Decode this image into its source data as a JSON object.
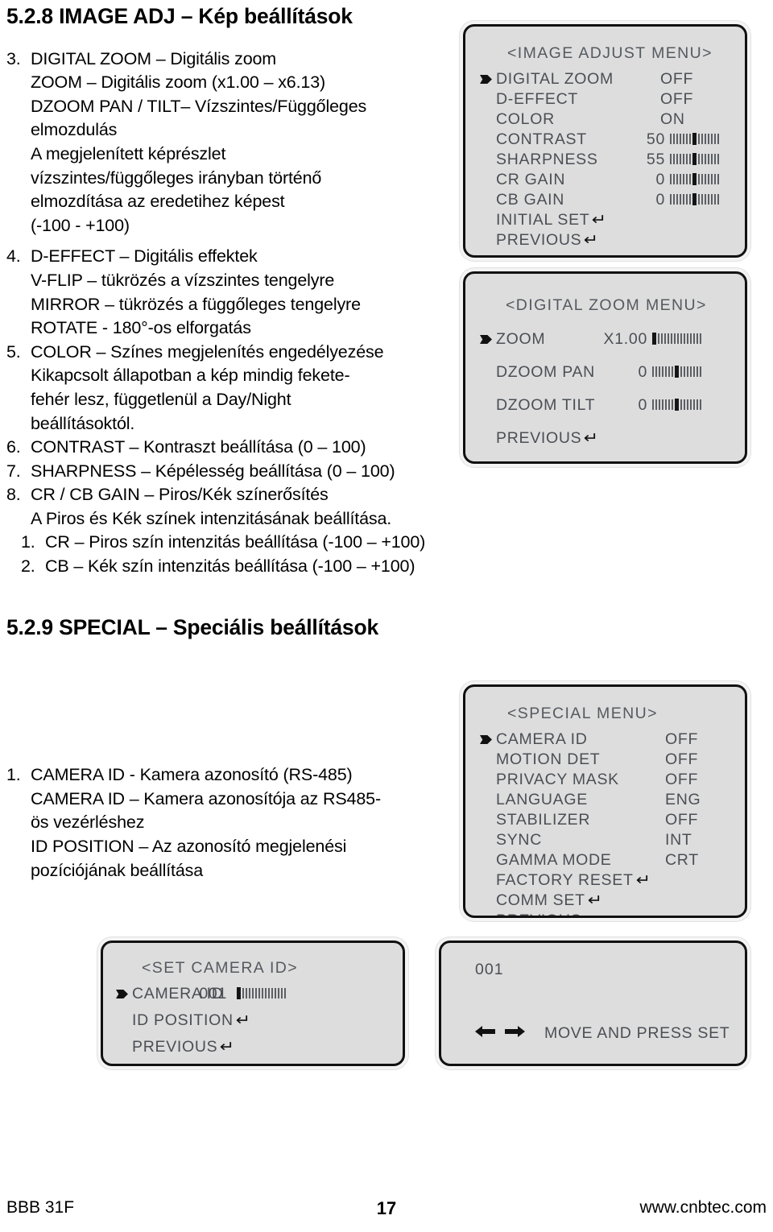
{
  "document": {
    "section_1": {
      "heading": "5.2.8 IMAGE ADJ – Kép beállítások",
      "items": [
        {
          "num": "3.",
          "lines": [
            "DIGITAL ZOOM – Digitális zoom",
            "ZOOM – Digitális zoom (x1.00 – x6.13)",
            "DZOOM PAN / TILT– Vízszintes/Függőleges",
            "elmozdulás",
            "A megjelenített képrészlet",
            "vízszintes/függőleges irányban történő",
            "elmozdítása az eredetihez képest",
            "(-100 - +100)"
          ]
        },
        {
          "num": "4.",
          "lines": [
            "D-EFFECT – Digitális effektek",
            "V-FLIP – tükrözés a vízszintes tengelyre",
            "MIRROR – tükrözés a függőleges tengelyre",
            "ROTATE - 180°-os elforgatás"
          ]
        },
        {
          "num": "5.",
          "lines": [
            "COLOR – Színes megjelenítés engedélyezése",
            "Kikapcsolt állapotban a kép mindig fekete-",
            "fehér lesz, függetlenül a Day/Night",
            "beállításoktól."
          ]
        },
        {
          "num": "6.",
          "lines": [
            "CONTRAST – Kontraszt beállítása (0 – 100)"
          ]
        },
        {
          "num": "7.",
          "lines": [
            "SHARPNESS – Képélesség beállítása (0 – 100)"
          ]
        },
        {
          "num": "8.",
          "lines": [
            "CR / CB GAIN – Piros/Kék színerősítés",
            "A Piros és Kék színek intenzitásának beállítása."
          ],
          "subitems": [
            {
              "num": "1.",
              "text": "CR – Piros szín intenzitás beállítása (-100 – +100)"
            },
            {
              "num": "2.",
              "text": "CB – Kék szín intenzitás beállítása (-100 – +100)"
            }
          ]
        }
      ]
    },
    "section_2": {
      "heading": "5.2.9 SPECIAL – Speciális beállítások",
      "items": [
        {
          "num": "1.",
          "lines": [
            "CAMERA ID - Kamera azonosító (RS-485)",
            "CAMERA ID – Kamera azonosítója az RS485-",
            "ös vezérléshez",
            "ID POSITION – Az azonosító megjelenési",
            "pozíciójának beállítása"
          ]
        }
      ]
    }
  },
  "osd_panels": {
    "image_adjust": {
      "title": "<IMAGE ADJUST MENU>",
      "rows": [
        {
          "cursor": true,
          "label": "DIGITAL ZOOM",
          "value": "OFF",
          "bar": null
        },
        {
          "cursor": false,
          "label": "D-EFFECT",
          "value": "OFF",
          "bar": null
        },
        {
          "cursor": false,
          "label": "COLOR",
          "value": "ON",
          "bar": null
        },
        {
          "cursor": false,
          "label": "CONTRAST",
          "value": "50",
          "bar": {
            "ticks": 15,
            "cursor_index": 7
          }
        },
        {
          "cursor": false,
          "label": "SHARPNESS",
          "value": "55",
          "bar": {
            "ticks": 15,
            "cursor_index": 7
          }
        },
        {
          "cursor": false,
          "label": "CR GAIN",
          "value": "0",
          "bar": {
            "ticks": 15,
            "cursor_index": 7
          }
        },
        {
          "cursor": false,
          "label": "CB GAIN",
          "value": "0",
          "bar": {
            "ticks": 15,
            "cursor_index": 7
          }
        },
        {
          "cursor": false,
          "label": "INITIAL SET",
          "value": "",
          "return": true
        },
        {
          "cursor": false,
          "label": "PREVIOUS",
          "value": "",
          "return": true
        }
      ]
    },
    "digital_zoom": {
      "title": "<DIGITAL ZOOM MENU>",
      "rows": [
        {
          "cursor": true,
          "label": "ZOOM",
          "value": "X1.00",
          "bar": {
            "ticks": 15,
            "cursor_index": 0
          }
        },
        {
          "cursor": false,
          "label": "DZOOM PAN",
          "value": "0",
          "bar": {
            "ticks": 15,
            "cursor_index": 7
          }
        },
        {
          "cursor": false,
          "label": "DZOOM TILT",
          "value": "0",
          "bar": {
            "ticks": 15,
            "cursor_index": 7
          }
        },
        {
          "cursor": false,
          "label": "PREVIOUS",
          "value": "",
          "return": true
        }
      ]
    },
    "special": {
      "title": "<SPECIAL MENU>",
      "rows": [
        {
          "cursor": true,
          "label": "CAMERA ID",
          "value": "OFF"
        },
        {
          "cursor": false,
          "label": "MOTION DET",
          "value": "OFF"
        },
        {
          "cursor": false,
          "label": "PRIVACY MASK",
          "value": "OFF"
        },
        {
          "cursor": false,
          "label": "LANGUAGE",
          "value": "ENG"
        },
        {
          "cursor": false,
          "label": "STABILIZER",
          "value": "OFF"
        },
        {
          "cursor": false,
          "label": "SYNC",
          "value": "INT"
        },
        {
          "cursor": false,
          "label": "GAMMA MODE",
          "value": "CRT"
        },
        {
          "cursor": false,
          "label": "FACTORY RESET",
          "value": "",
          "return": true
        },
        {
          "cursor": false,
          "label": "COMM SET",
          "value": "",
          "return": true
        },
        {
          "cursor": false,
          "label": "PREVIOUS",
          "value": "",
          "return": true
        }
      ]
    },
    "set_camera_id": {
      "title": "<SET CAMERA ID>",
      "rows": [
        {
          "cursor": true,
          "label": "CAMERA ID",
          "value": "001",
          "bar": {
            "ticks": 15,
            "cursor_index": 0
          }
        },
        {
          "cursor": false,
          "label": "ID POSITION",
          "value": "",
          "return": true
        },
        {
          "cursor": false,
          "label": "PREVIOUS",
          "value": "",
          "return": true
        }
      ]
    },
    "id_position": {
      "id_value": "001",
      "hint": "MOVE AND PRESS SET"
    }
  },
  "footer": {
    "model": "BBB 31F",
    "page": "17",
    "website": "www.cnbtec.com"
  }
}
